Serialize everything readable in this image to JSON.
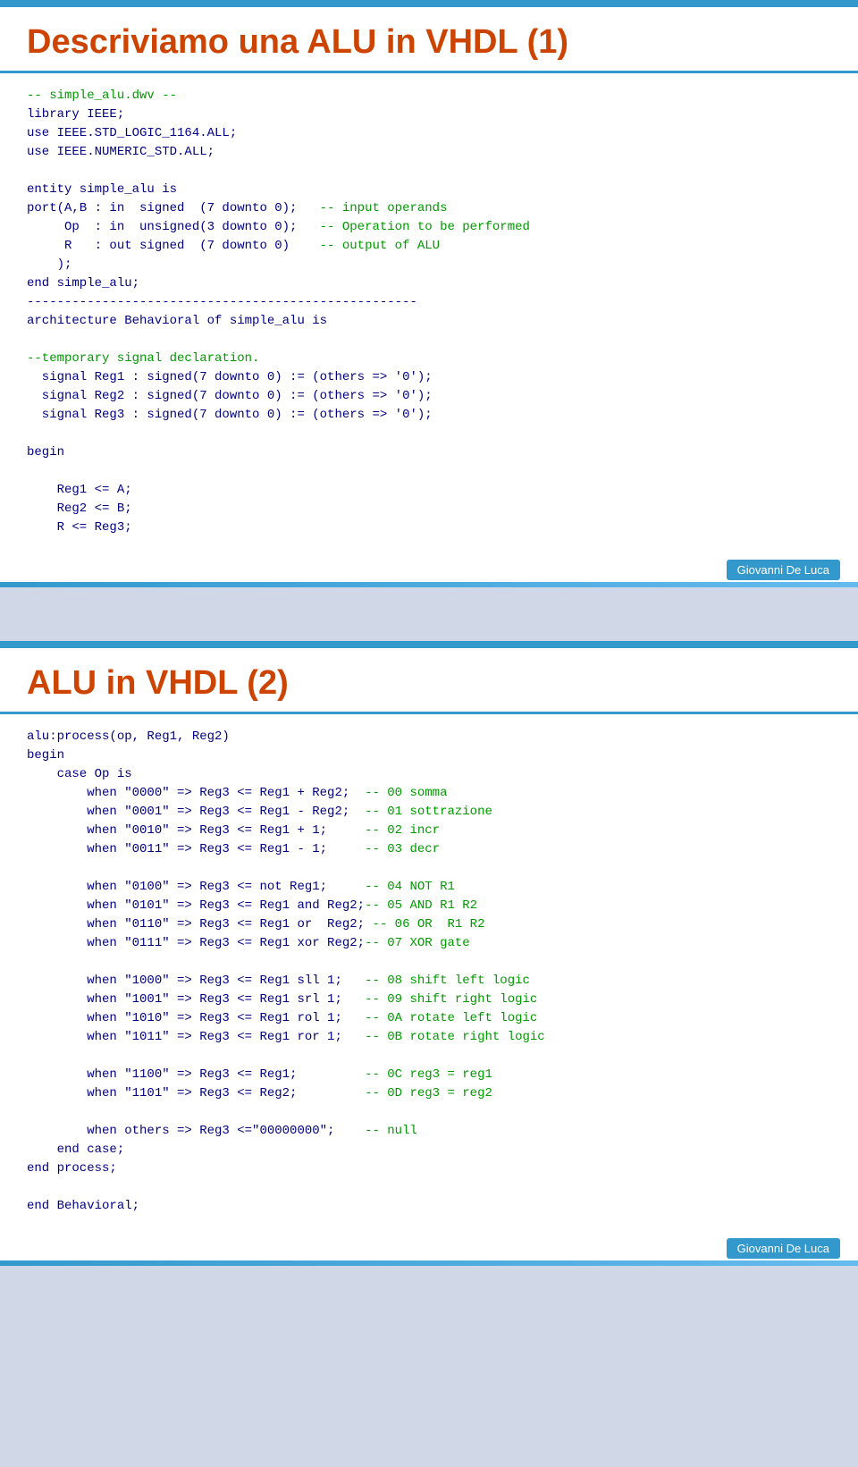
{
  "slide1": {
    "title": "Descriviamo una ALU in VHDL (1)",
    "footer": "Giovanni De Luca",
    "code_lines": [
      {
        "text": "-- simple_alu.dwv --",
        "type": "comment"
      },
      {
        "text": "library IEEE;",
        "type": "code"
      },
      {
        "text": "use IEEE.STD_LOGIC_1164.ALL;",
        "type": "code"
      },
      {
        "text": "use IEEE.NUMERIC_STD.ALL;",
        "type": "code"
      },
      {
        "text": "",
        "type": "blank"
      },
      {
        "text": "entity simple_alu is",
        "type": "code"
      },
      {
        "text": "port(A,B : in  signed  (7 downto 0);   -- input operands",
        "type": "mixed"
      },
      {
        "text": "     Op  : in  unsigned(3 downto 0);   -- Operation to be performed",
        "type": "mixed"
      },
      {
        "text": "     R   : out signed  (7 downto 0)    -- output of ALU",
        "type": "mixed"
      },
      {
        "text": "    );",
        "type": "code"
      },
      {
        "text": "end simple_alu;",
        "type": "code"
      },
      {
        "text": "----------------------------------------------------",
        "type": "code"
      },
      {
        "text": "architecture Behavioral of simple_alu is",
        "type": "code"
      },
      {
        "text": "",
        "type": "blank"
      },
      {
        "text": "--temporary signal declaration.",
        "type": "comment"
      },
      {
        "text": "  signal Reg1 : signed(7 downto 0) := (others => '0');",
        "type": "code"
      },
      {
        "text": "  signal Reg2 : signed(7 downto 0) := (others => '0');",
        "type": "code"
      },
      {
        "text": "  signal Reg3 : signed(7 downto 0) := (others => '0');",
        "type": "code"
      },
      {
        "text": "",
        "type": "blank"
      },
      {
        "text": "begin",
        "type": "code"
      },
      {
        "text": "",
        "type": "blank"
      },
      {
        "text": "    Reg1 <= A;",
        "type": "code"
      },
      {
        "text": "    Reg2 <= B;",
        "type": "code"
      },
      {
        "text": "    R <= Reg3;",
        "type": "code"
      }
    ]
  },
  "slide2": {
    "title": "ALU in VHDL (2)",
    "footer": "Giovanni De Luca",
    "code_lines": [
      {
        "text": "alu:process(op, Reg1, Reg2)",
        "type": "code"
      },
      {
        "text": "begin",
        "type": "code"
      },
      {
        "text": "    case Op is",
        "type": "code"
      },
      {
        "text": "        when \"0000\" => Reg3 <= Reg1 + Reg2;  -- 00 somma",
        "type": "mixed"
      },
      {
        "text": "        when \"0001\" => Reg3 <= Reg1 - Reg2;  -- 01 sottrazione",
        "type": "mixed"
      },
      {
        "text": "        when \"0010\" => Reg3 <= Reg1 + 1;     -- 02 incr",
        "type": "mixed"
      },
      {
        "text": "        when \"0011\" => Reg3 <= Reg1 - 1;     -- 03 decr",
        "type": "mixed"
      },
      {
        "text": "",
        "type": "blank"
      },
      {
        "text": "        when \"0100\" => Reg3 <= not Reg1;     -- 04 NOT R1",
        "type": "mixed"
      },
      {
        "text": "        when \"0101\" => Reg3 <= Reg1 and Reg2;-- 05 AND R1 R2",
        "type": "mixed"
      },
      {
        "text": "        when \"0110\" => Reg3 <= Reg1 or  Reg2; -- 06 OR  R1 R2",
        "type": "mixed"
      },
      {
        "text": "        when \"0111\" => Reg3 <= Reg1 xor Reg2;-- 07 XOR gate",
        "type": "mixed"
      },
      {
        "text": "",
        "type": "blank"
      },
      {
        "text": "        when \"1000\" => Reg3 <= Reg1 sll 1;   -- 08 shift left logic",
        "type": "mixed"
      },
      {
        "text": "        when \"1001\" => Reg3 <= Reg1 srl 1;   -- 09 shift right logic",
        "type": "mixed"
      },
      {
        "text": "        when \"1010\" => Reg3 <= Reg1 rol 1;   -- 0A rotate left logic",
        "type": "mixed"
      },
      {
        "text": "        when \"1011\" => Reg3 <= Reg1 ror 1;   -- 0B rotate right logic",
        "type": "mixed"
      },
      {
        "text": "",
        "type": "blank"
      },
      {
        "text": "        when \"1100\" => Reg3 <= Reg1;         -- 0C reg3 = reg1",
        "type": "mixed"
      },
      {
        "text": "        when \"1101\" => Reg3 <= Reg2;         -- 0D reg3 = reg2",
        "type": "mixed"
      },
      {
        "text": "",
        "type": "blank"
      },
      {
        "text": "        when others => Reg3 <=\"00000000\";    -- null",
        "type": "mixed"
      },
      {
        "text": "    end case;",
        "type": "code"
      },
      {
        "text": "end process;",
        "type": "code"
      },
      {
        "text": "",
        "type": "blank"
      },
      {
        "text": "end Behavioral;",
        "type": "code"
      }
    ]
  }
}
